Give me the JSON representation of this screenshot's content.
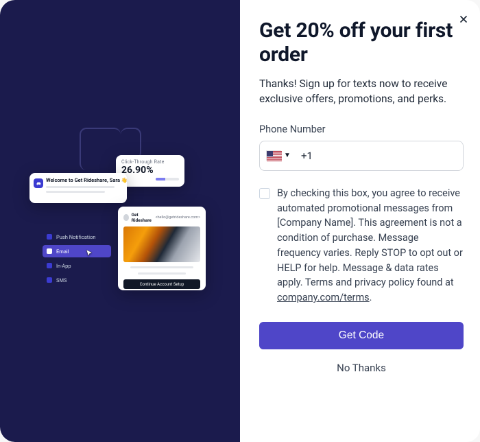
{
  "modal": {
    "heading": "Get 20% off your first order",
    "description": "Thanks! Sign up for texts now to receive exclusive offers, promotions, and perks.",
    "phone_label": "Phone Number",
    "phone_country_code": "+1",
    "phone_input_value": "",
    "consent_text_prefix": "By checking this box, you agree to receive automated promotional messages from [Company Name]. This agreement is not a condition of purchase. Message frequency varies. Reply STOP to opt out or HELP for help. Message & data rates apply. Terms and privacy policy found at ",
    "consent_link_text": "company.com/terms",
    "consent_text_suffix": ".",
    "primary_button": "Get Code",
    "secondary_button": "No Thanks",
    "close_label": "Close"
  },
  "left_panel": {
    "ctr_card": {
      "label": "Click-Through Rate",
      "value": "26.90%"
    },
    "welcome_card": {
      "title": "Welcome to Get Rideshare, Sara 👋"
    },
    "preview_card": {
      "from_name": "Get Rideshare",
      "from_addr": "<hello@getrideshare.com>",
      "cta_label": "Continue Account Setup"
    },
    "nav": {
      "items": [
        {
          "label": "Push Notification",
          "active": false
        },
        {
          "label": "Email",
          "active": true
        },
        {
          "label": "In-App",
          "active": false
        },
        {
          "label": "SMS",
          "active": false
        }
      ]
    }
  },
  "colors": {
    "accent": "#4f46c8",
    "dark_bg": "#1b1b4d"
  }
}
